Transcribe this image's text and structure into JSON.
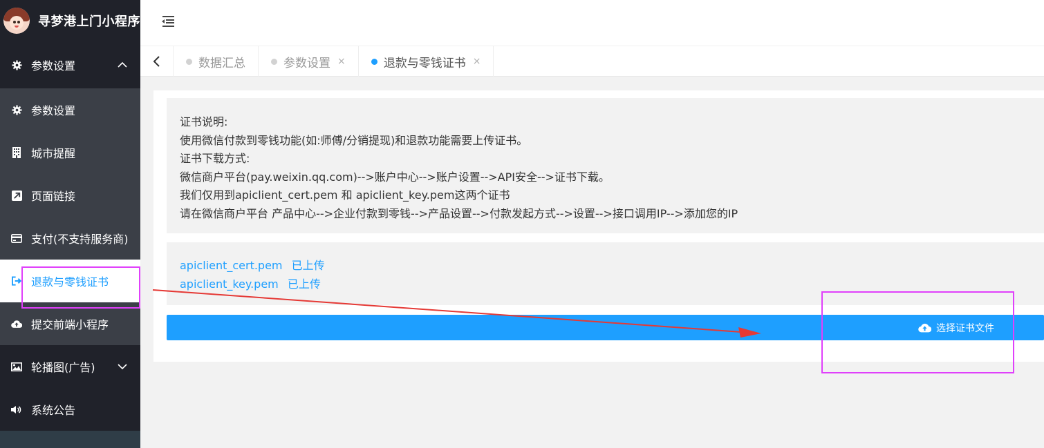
{
  "brand": {
    "title": "寻梦港上门小程序"
  },
  "sidebar": {
    "group_top": {
      "label": "参数设置",
      "icon": "gear-icon"
    },
    "items": [
      {
        "label": "参数设置",
        "icon": "gear-icon"
      },
      {
        "label": "城市提醒",
        "icon": "building-icon"
      },
      {
        "label": "页面链接",
        "icon": "external-link-icon"
      },
      {
        "label": "支付(不支持服务商)",
        "icon": "credit-card-icon"
      },
      {
        "label": "退款与零钱证书",
        "icon": "sign-out-icon"
      },
      {
        "label": "提交前端小程序",
        "icon": "cloud-upload-icon"
      }
    ],
    "group_bottom": [
      {
        "label": "轮播图(广告)",
        "icon": "image-icon"
      },
      {
        "label": "系统公告",
        "icon": "volume-icon"
      }
    ]
  },
  "tabs": [
    {
      "label": "数据汇总",
      "closable": false,
      "active": false
    },
    {
      "label": "参数设置",
      "closable": true,
      "close": "×",
      "active": false
    },
    {
      "label": "退款与零钱证书",
      "closable": true,
      "close": "×",
      "active": true
    }
  ],
  "info": {
    "lines": [
      "证书说明:",
      "使用微信付款到零钱功能(如:师傅/分销提现)和退款功能需要上传证书。",
      "证书下载方式:",
      "微信商户平台(pay.weixin.qq.com)-->账户中心-->账户设置-->API安全-->证书下载。",
      "我们仅用到apiclient_cert.pem 和 apiclient_key.pem这两个证书",
      "请在微信商户平台 产品中心-->企业付款到零钱-->产品设置-->付款发起方式-->设置-->接口调用IP-->添加您的IP"
    ]
  },
  "certs": [
    {
      "file": "apiclient_cert.pem",
      "status": "已上传"
    },
    {
      "file": "apiclient_key.pem",
      "status": "已上传"
    }
  ],
  "upload": {
    "label": "选择证书文件",
    "icon": "cloud-upload-icon"
  },
  "colors": {
    "accent": "#1e9fff",
    "sidebar_dark": "#20222a",
    "sidebar_sub": "#3b3f47",
    "annotation": "#e040fb",
    "arrow": "#e53935"
  }
}
